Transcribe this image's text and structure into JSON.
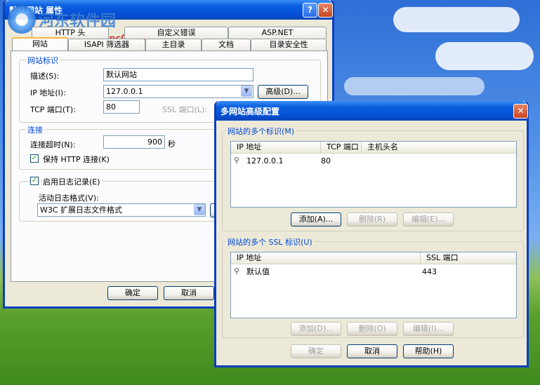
{
  "watermark": {
    "logo_text": "河东软件园",
    "url": "www.pc0359.cn"
  },
  "main_dialog": {
    "title": "默认网站 属性",
    "help_btn": "?",
    "close_btn": "✕",
    "tabs_row1": [
      "HTTP 头",
      "自定义错误",
      "ASP.NET"
    ],
    "tabs_row2": [
      "网站",
      "ISAPI 筛选器",
      "主目录",
      "文档",
      "目录安全性"
    ],
    "site_id_group": "网站标识",
    "desc_label": "描述(S):",
    "desc_value": "默认网站",
    "ip_label": "IP 地址(I):",
    "ip_value": "127.0.0.1",
    "advanced_btn": "高级(D)...",
    "tcp_label": "TCP 端口(T):",
    "tcp_value": "80",
    "ssl_label": "SSL 端口(L):",
    "conn_group": "连接",
    "timeout_label": "连接超时(N):",
    "timeout_value": "900",
    "timeout_unit": "秒",
    "keepalive_label": "保持 HTTP 连接(K)",
    "keepalive_checked": true,
    "logging_label": "启用日志记录(E)",
    "logging_checked": true,
    "log_format_label": "活动日志格式(V):",
    "log_format_value": "W3C 扩展日志文件格式",
    "ok_btn": "确定",
    "cancel_btn": "取消"
  },
  "adv_dialog": {
    "title": "多网站高级配置",
    "close_btn": "✕",
    "ids_group": "网站的多个标识(M)",
    "ids_columns": [
      "IP 地址",
      "TCP 端口",
      "主机头名"
    ],
    "ids_rows": [
      {
        "ip": "127.0.0.1",
        "port": "80",
        "host": ""
      }
    ],
    "ids_add": "添加(A)...",
    "ids_remove": "删除(R)",
    "ids_edit": "编辑(E)...",
    "ssl_group": "网站的多个 SSL 标识(U)",
    "ssl_columns": [
      "IP 地址",
      "SSL 端口"
    ],
    "ssl_rows": [
      {
        "ip": "默认值",
        "port": "443"
      }
    ],
    "ssl_add": "添加(D)...",
    "ssl_remove": "删除(O)",
    "ssl_edit": "编辑(I)...",
    "ok_btn": "确定",
    "cancel_btn": "取消",
    "help_btn": "帮助(H)"
  }
}
